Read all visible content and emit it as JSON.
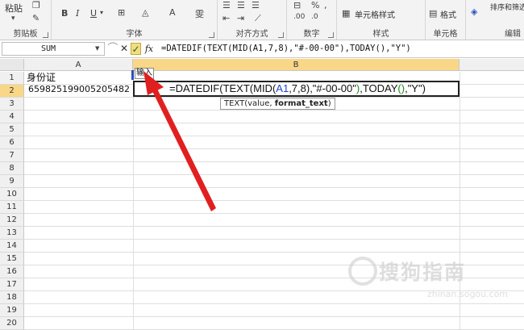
{
  "ribbon": {
    "paste_label": "粘贴",
    "groups": {
      "clipboard": "剪贴板",
      "font": "字体",
      "alignment": "对齐方式",
      "number": "数字",
      "styles": "样式",
      "cells": "单元格",
      "editing": "编辑"
    },
    "cell_styles_label": "单元格样式",
    "format_label": "格式",
    "sort_filter_label": "排序和筛选",
    "bold": "B",
    "italic": "I",
    "underline": "U",
    "font_color_glyph": "A",
    "wrap_glyph": "雯"
  },
  "formula_bar": {
    "name_box": "SUM",
    "cancel_glyph": "✕",
    "enter_glyph": "✓",
    "fx_label": "fx",
    "formula": "=DATEDIF(TEXT(MID(A1,7,8),\"#-00-00\"),TODAY(),\"Y\")"
  },
  "grid": {
    "columns": [
      "A",
      "B"
    ],
    "rows": [
      "1",
      "2",
      "3",
      "4",
      "5",
      "6",
      "7",
      "8",
      "9",
      "10",
      "11",
      "12",
      "13",
      "14",
      "15",
      "16",
      "17",
      "18",
      "19",
      "20"
    ],
    "a1": "身份证",
    "a2": "659825199005205482",
    "edit_parts": {
      "p1": "=DATEDIF(TEXT(MID(",
      "p2": "A1",
      "p3": ",7,8),\"#-00-00\"",
      "p4": ")",
      "p5": ",TODAY",
      "p6": "()",
      "p7": ",\"Y\")"
    },
    "tooltip_fn": "TEXT(value, ",
    "tooltip_arg": "format_text",
    "tooltip_close": ")",
    "callout": "输入"
  },
  "watermark": {
    "main": "搜狗指南",
    "sub": "zhinan.sogou.com"
  },
  "colors": {
    "arrow": "#e02020",
    "active_header": "#f9d788",
    "ref_blue": "#2040d0",
    "paren_green": "#1a8a1a"
  }
}
